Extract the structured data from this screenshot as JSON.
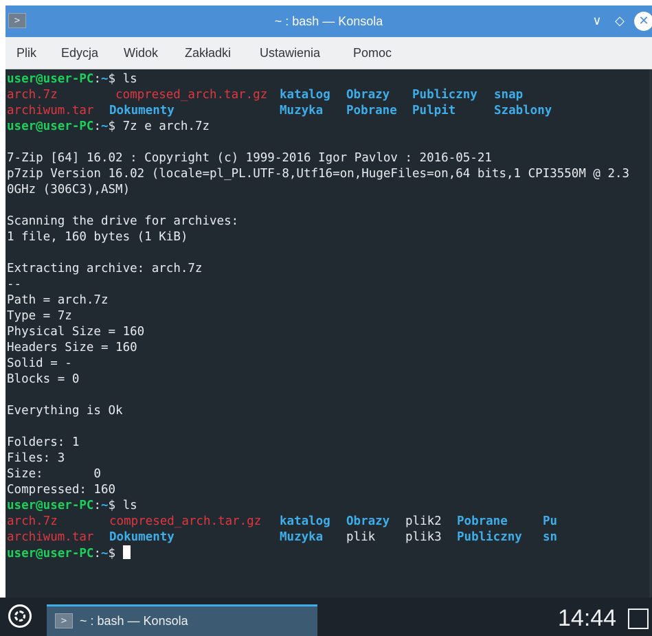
{
  "window": {
    "title": "~ : bash — Konsola",
    "app_icon_glyph": ">",
    "minimize_glyph": "∨",
    "maximize_glyph": "◇",
    "close_glyph": "✕"
  },
  "menu": [
    "Plik",
    "Edycja",
    "Widok",
    "Zakładki",
    "Ustawienia",
    "Pomoc"
  ],
  "terminal": {
    "prompt_user": "user@user-PC",
    "prompt_colon": ":",
    "prompt_path": "~",
    "prompt_symbol": "$ ",
    "cmd1": "ls",
    "ls1_row1": [
      "arch.7z",
      "compresed_arch.tar.gz",
      "katalog",
      "Obrazy",
      "Publiczny",
      "snap"
    ],
    "ls1_row2": [
      "archiwum.tar",
      "Dokumenty",
      "Muzyka",
      "Pobrane",
      "Pulpit",
      "Szablony"
    ],
    "cmd2": "7z e arch.7z",
    "output": [
      "7-Zip [64] 16.02 : Copyright (c) 1999-2016 Igor Pavlov : 2016-05-21",
      "p7zip Version 16.02 (locale=pl_PL.UTF-8,Utf16=on,HugeFiles=on,64 bits,1 CPI3550M @ 2.3",
      "0GHz (306C3),ASM)",
      "Scanning the drive for archives:",
      "1 file, 160 bytes (1 KiB)",
      "Extracting archive: arch.7z",
      "--",
      "Path = arch.7z",
      "Type = 7z",
      "Physical Size = 160",
      "Headers Size = 160",
      "Solid = -",
      "Blocks = 0",
      "Everything is Ok",
      "Folders: 1",
      "Files: 3",
      "Size:       0",
      "Compressed: 160"
    ],
    "cmd3": "ls",
    "ls2_row1": [
      "arch.7z",
      "compresed_arch.tar.gz",
      "katalog",
      "Obrazy",
      "plik2",
      "Pobrane",
      "Pu"
    ],
    "ls2_row2": [
      "archiwum.tar",
      "Dokumenty",
      "Muzyka",
      "plik",
      "plik3",
      "Publiczny",
      "sn"
    ]
  },
  "taskbar": {
    "task_label": "~ : bash — Konsola",
    "task_icon_glyph": ">",
    "clock": "14:44"
  },
  "colors": {
    "titlebar": "#4b8fd6",
    "terminal_bg": "#222a31",
    "prompt_user": "#1cd15a",
    "prompt_path": "#3daee9",
    "archive_red": "#e2363f",
    "directory_blue": "#3daee9"
  }
}
